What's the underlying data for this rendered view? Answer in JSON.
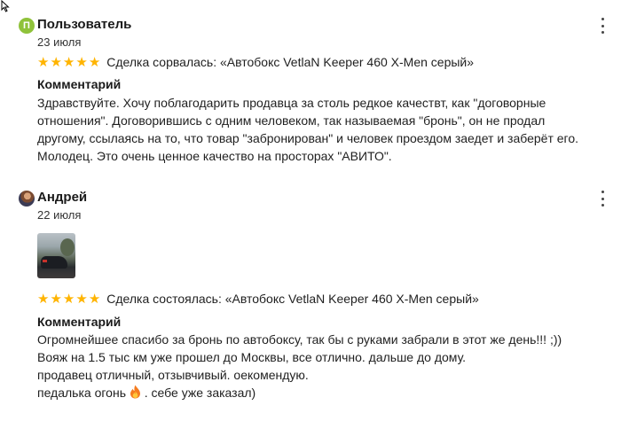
{
  "reviews": [
    {
      "avatar_letter": "П",
      "avatar_color": "#8fc23a",
      "author": "Пользователь",
      "date": "23 июля",
      "rating": 5,
      "deal_text": "Сделка сорвалась: «Автобокс VetlaN Keeper 460 X-Men серый»",
      "comment_heading": "Комментарий",
      "comment_lines": [
        "Здравствуйте. Хочу поблагодарить продавца за столь редкое качествт, как \"договорные",
        "отношения\". Договорившись с одним человеком, так называемая \"бронь\", он не продал",
        "другому, ссылаясь на то, что товар \"забронирован\" и человек проездом заедет и заберёт его.",
        "Молодец. Это очень ценное качество на просторах \"АВИТО\"."
      ]
    },
    {
      "author": "Андрей",
      "date": "22 июля",
      "rating": 5,
      "deal_text": "Сделка состоялась: «Автобокс VetlaN Keeper 460 X-Men серый»",
      "comment_heading": "Комментарий",
      "comment_lines": [
        "Огромнейшее спасибо за бронь по автобоксу, так бы с руками забрали в этот же день!!! ;))",
        "Вояж на 1.5 тыс км уже прошел до Москвы, все отлично. дальше до дому.",
        "продавец отличный, отзывчивый. оекомендую."
      ],
      "last_line_before_emoji": "педалька огонь ",
      "last_line_after_emoji": " . себе уже заказал)"
    }
  ],
  "star_color": "#ffb400",
  "icons": [
    "cursor-arrow-icon",
    "more-vertical-icon",
    "star-icon",
    "fire-emoji-icon"
  ]
}
